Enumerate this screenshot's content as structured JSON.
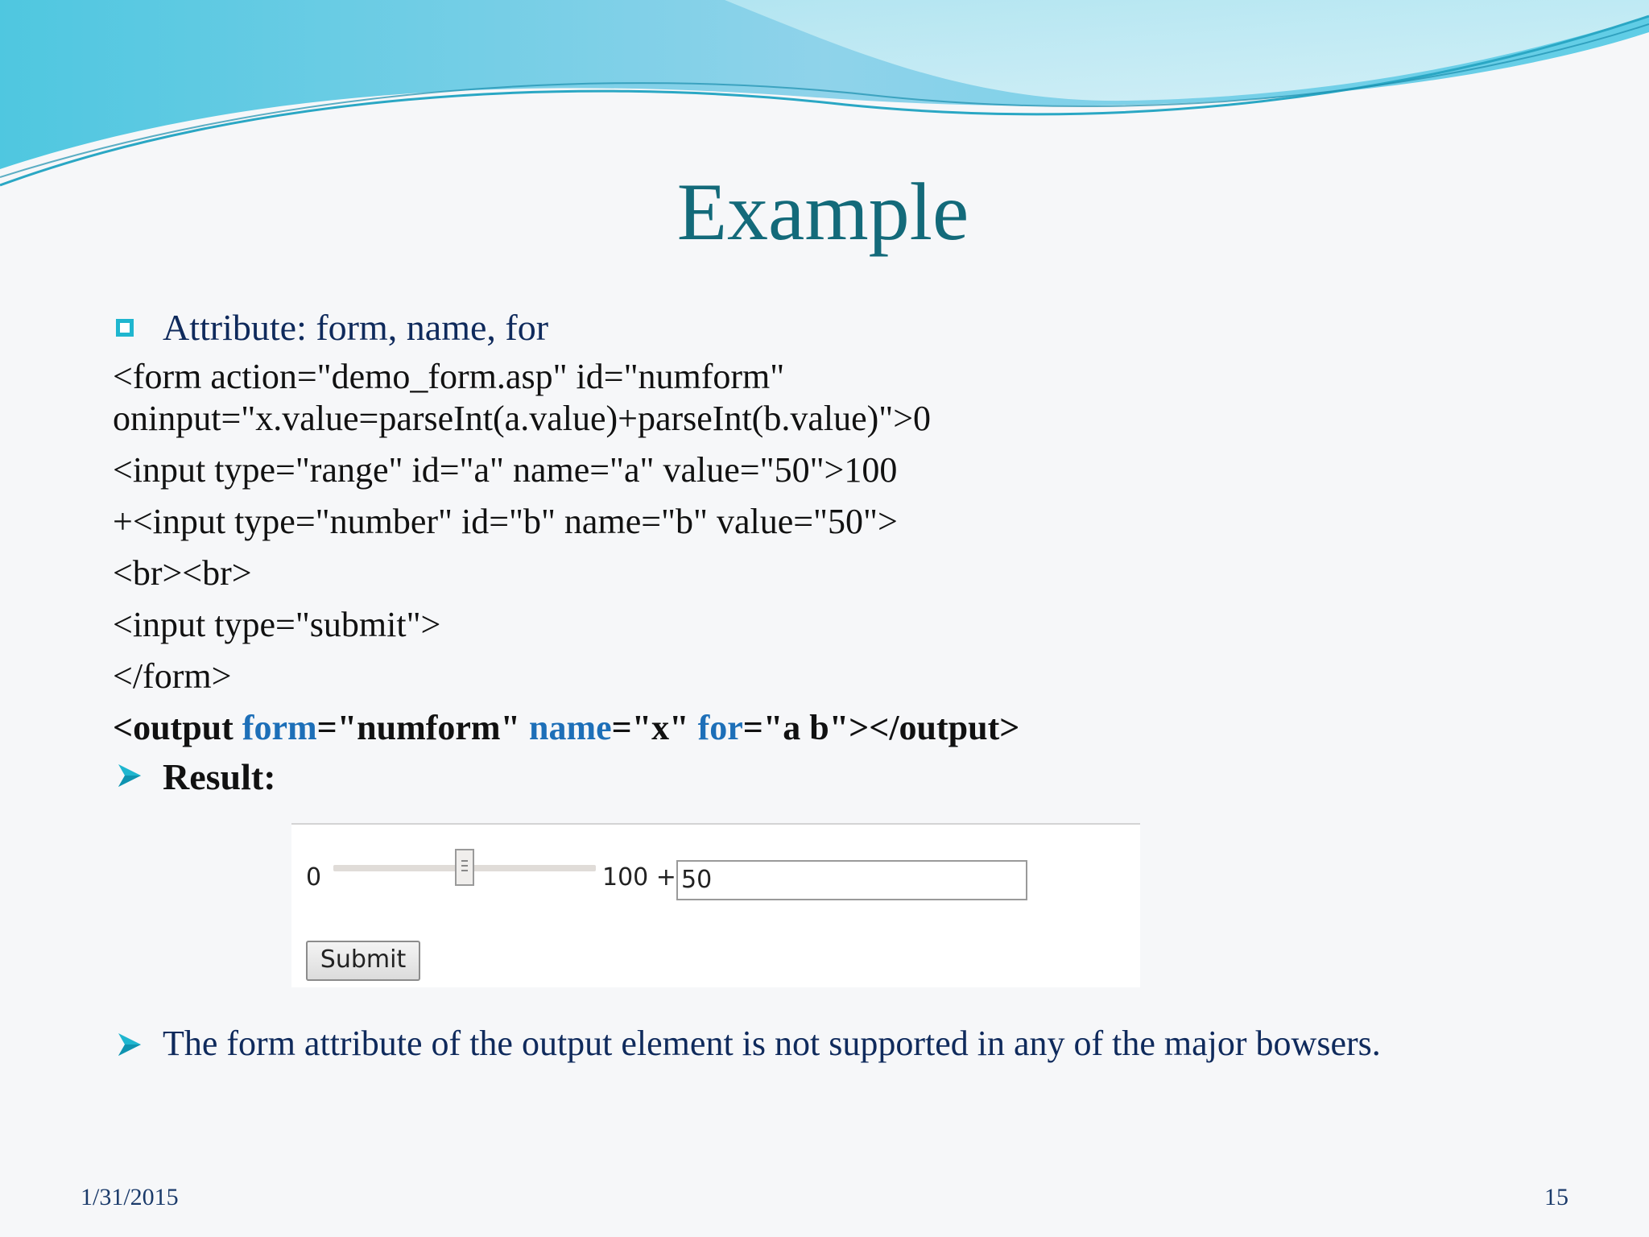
{
  "slide": {
    "title": "Example",
    "bullet_heading": "Attribute: form, name, for",
    "code_lines": [
      "<form action=\"demo_form.asp\" id=\"numform\"",
      "oninput=\"x.value=parseInt(a.value)+parseInt(b.value)\">0",
      "<input type=\"range\" id=\"a\" name=\"a\" value=\"50\">100",
      "+<input type=\"number\" id=\"b\" name=\"b\" value=\"50\">",
      "<br><br>",
      "<input type=\"submit\">",
      "</form>"
    ],
    "output_line": {
      "p1": "<output ",
      "k1": "form",
      "p2": "=\"numform\" ",
      "k2": "name",
      "p3": "=\"x\" ",
      "k3": "for",
      "p4": "=\"a b\"></output>"
    },
    "result_label": "Result:",
    "result": {
      "range_min_label": "0",
      "range_max_label": "100 +",
      "range_value": 50,
      "number_value": "50",
      "submit_label": "Submit"
    },
    "note": "The form attribute of the output element is not supported in any of the major bowsers.",
    "date": "1/31/2015",
    "page_number": "15"
  },
  "colors": {
    "title": "#136a7a",
    "bullet_text": "#0f2a5c",
    "keyword": "#1d6fb8",
    "accent": "#1fb6cf"
  }
}
